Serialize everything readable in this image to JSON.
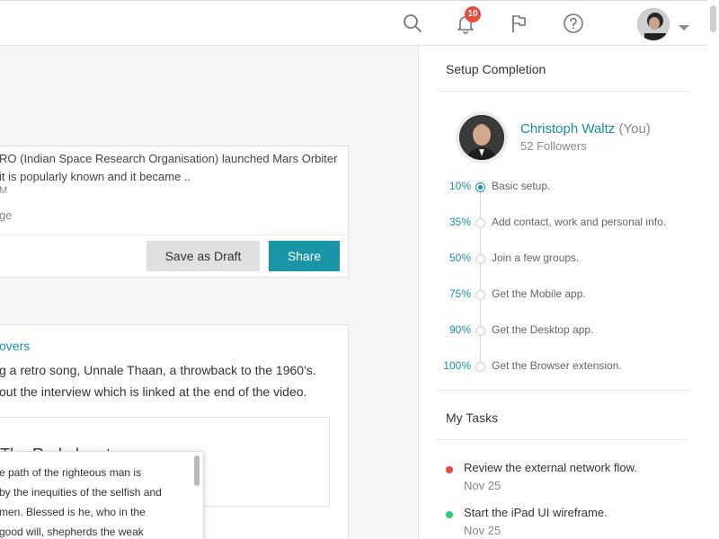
{
  "topbar": {
    "notification_count": "10",
    "icons": [
      "search-icon",
      "bell-icon",
      "flag-icon",
      "help-icon",
      "chevron-down-icon"
    ]
  },
  "feed": {
    "post1": {
      "text_line1": "RO (Indian Space Research Organisation) launched Mars Orbiter",
      "text_line2": "it is popularly known and it became ..",
      "meta": "M",
      "tag": "ge",
      "save_draft_label": "Save as Draft",
      "share_label": "Share"
    },
    "post2": {
      "link": "overs",
      "text_line1": "g a retro song, Unnale Thaan, a throwback to the 1960's.",
      "text_line2": "out the interview which is linked at the end of the video.",
      "inner_title": "The Red planet"
    },
    "popup": {
      "line1": "e path of the righteous man is",
      "line2": "by the inequities of the selfish and",
      "line3": "men. Blessed is he, who in the",
      "line4": "good will, shepherds the weak"
    }
  },
  "setup": {
    "heading": "Setup Completion",
    "profile_name": "Christoph Waltz",
    "profile_you": "(You)",
    "followers": "52 Followers",
    "steps": [
      {
        "pct": "10%",
        "label": "Basic setup.",
        "active": true
      },
      {
        "pct": "35%",
        "label": "Add contact, work and personal info.",
        "active": false
      },
      {
        "pct": "50%",
        "label": "Join a few groups.",
        "active": false
      },
      {
        "pct": "75%",
        "label": "Get the Mobile app.",
        "active": false
      },
      {
        "pct": "90%",
        "label": "Get the Desktop app.",
        "active": false
      },
      {
        "pct": "100%",
        "label": "Get the Browser extension.",
        "active": false
      }
    ]
  },
  "tasks": {
    "heading": "My Tasks",
    "items": [
      {
        "title": "Review the external network flow.",
        "date": "Nov 25",
        "color": "#e74c3c"
      },
      {
        "title": "Start the iPad UI wireframe.",
        "date": "Nov 25",
        "color": "#2ecc71"
      }
    ]
  },
  "colors": {
    "accent": "#1a95a6",
    "badge": "#e74c3c"
  }
}
